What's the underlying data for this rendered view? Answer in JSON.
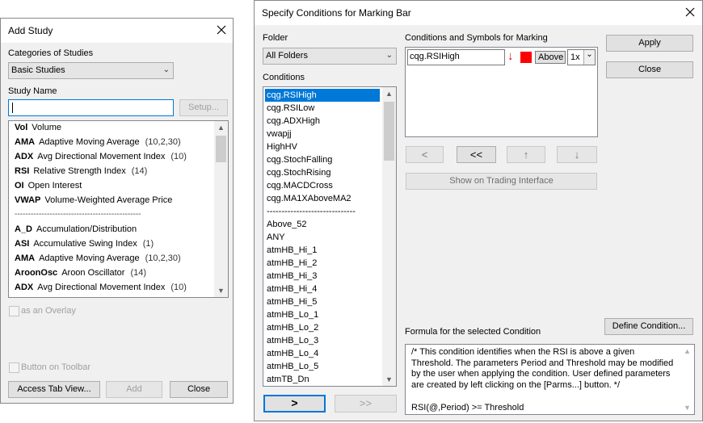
{
  "add_study": {
    "title": "Add Study",
    "categories_label": "Categories of Studies",
    "categories_value": "Basic Studies",
    "study_name_label": "Study Name",
    "study_name_value": "",
    "setup_label": "Setup...",
    "studies": [
      {
        "code": "Vol",
        "name": "Volume",
        "params": ""
      },
      {
        "code": "AMA",
        "name": "Adaptive Moving Average",
        "params": "(10,2,30)"
      },
      {
        "code": "ADX",
        "name": "Avg Directional Movement Index",
        "params": "(10)"
      },
      {
        "code": "RSI",
        "name": "Relative Strength Index",
        "params": "(14)"
      },
      {
        "code": "OI",
        "name": "Open Interest",
        "params": ""
      },
      {
        "code": "VWAP",
        "name": "Volume-Weighted Average Price",
        "params": ""
      },
      {
        "code": "A_D",
        "name": "Accumulation/Distribution",
        "params": ""
      },
      {
        "code": "ASI",
        "name": "Accumulative Swing Index",
        "params": "(1)"
      },
      {
        "code": "AMA",
        "name": "Adaptive Moving Average",
        "params": "(10,2,30)"
      },
      {
        "code": "AroonOsc",
        "name": "Aroon Oscillator",
        "params": "(14)"
      },
      {
        "code": "ADX",
        "name": "Avg Directional Movement Index",
        "params": "(10)"
      }
    ],
    "separator": "-----------------------------------------------",
    "overlay_label": "as an Overlay",
    "toolbar_label": "Button on Toolbar",
    "access_tab_label": "Access Tab View...",
    "add_label": "Add",
    "close_label": "Close"
  },
  "conditions_dialog": {
    "title": "Specify Conditions for Marking Bar",
    "folder_label": "Folder",
    "folder_value": "All Folders",
    "conditions_label": "Conditions",
    "conditions": [
      "cqg.RSIHigh",
      "cqg.RSILow",
      "cqg.ADXHigh",
      "vwapjj",
      "HighHV",
      "cqg.StochFalling",
      "cqg.StochRising",
      "cqg.MACDCross",
      "cqg.MA1XAboveMA2",
      "------------------------------",
      "Above_52",
      "ANY",
      "atmHB_Hi_1",
      "atmHB_Hi_2",
      "atmHB_Hi_3",
      "atmHB_Hi_4",
      "atmHB_Hi_5",
      "atmHB_Lo_1",
      "atmHB_Lo_2",
      "atmHB_Lo_3",
      "atmHB_Lo_4",
      "atmHB_Lo_5",
      "atmTB_Dn"
    ],
    "selected_condition": "cqg.RSIHigh",
    "marking_label": "Conditions and Symbols for Marking",
    "marking_row": {
      "condition": "cqg.RSIHigh",
      "arrow": "↓",
      "position": "Above",
      "multiplier": "1x"
    },
    "arrow_color": "#e00000",
    "mark_color": "#ff0000",
    "nav_buttons": [
      "<",
      "<<",
      "↑",
      "↓"
    ],
    "show_trading_label": "Show on Trading Interface",
    "apply_label": "Apply",
    "close_label": "Close",
    "define_label": "Define Condition...",
    "formula_label": "Formula for the selected Condition",
    "formula_lines": [
      "/* This condition identifies when the RSI is above a given",
      "Threshold.  The parameters Period and Threshold may be modified",
      "by the user when applying the condition.  User defined parameters",
      "are created by left clicking on the [Parms...] button. */",
      "",
      "RSI(@,Period) >= Threshold"
    ],
    "add_one_label": ">",
    "add_all_label": ">>"
  }
}
